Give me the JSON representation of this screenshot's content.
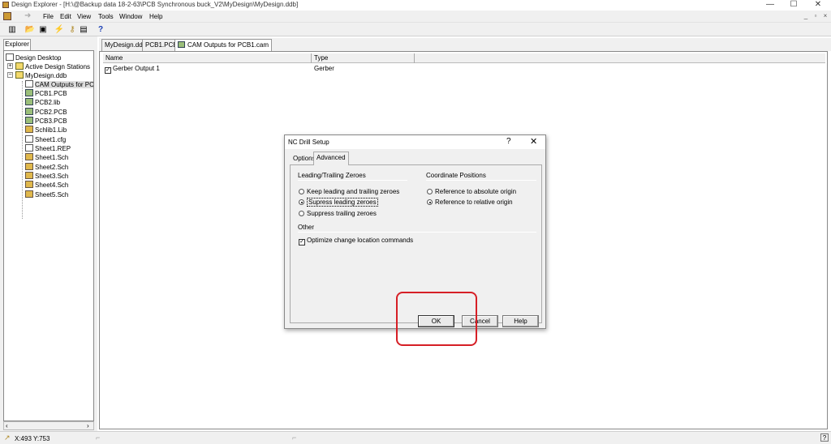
{
  "window": {
    "title": "Design Explorer - [H:\\@Backup data 18-2-63\\PCB Synchronous buck_V2\\MyDesign\\MyDesign.ddb]",
    "controls": [
      "—",
      "☐",
      "✕"
    ]
  },
  "menu": {
    "items": [
      "File",
      "Edit",
      "View",
      "Tools",
      "Window",
      "Help"
    ],
    "mdi_controls": [
      "_",
      "▫",
      "×"
    ]
  },
  "toolbar": {
    "help_glyph": "?"
  },
  "explorer": {
    "tab_label": "Explorer",
    "tree": [
      {
        "label": "Design Desktop",
        "kind": "doc"
      },
      {
        "label": "Active Design Stations",
        "kind": "folder"
      },
      {
        "label": "MyDesign.ddb",
        "kind": "folder"
      },
      {
        "label": "CAM Outputs for PC",
        "kind": "doc"
      },
      {
        "label": "PCB1.PCB",
        "kind": "pcb"
      },
      {
        "label": "PCB2.lib",
        "kind": "pcb"
      },
      {
        "label": "PCB2.PCB",
        "kind": "pcb"
      },
      {
        "label": "PCB3.PCB",
        "kind": "pcb"
      },
      {
        "label": "Schlib1.Lib",
        "kind": "sch"
      },
      {
        "label": "Sheet1.cfg",
        "kind": "doc"
      },
      {
        "label": "Sheet1.REP",
        "kind": "doc"
      },
      {
        "label": "Sheet1.Sch",
        "kind": "sch"
      },
      {
        "label": "Sheet2.Sch",
        "kind": "sch"
      },
      {
        "label": "Sheet3.Sch",
        "kind": "sch"
      },
      {
        "label": "Sheet4.Sch",
        "kind": "sch"
      },
      {
        "label": "Sheet5.Sch",
        "kind": "sch"
      }
    ]
  },
  "doc_tabs": [
    "MyDesign.ddb",
    "PCB1.PCB",
    "CAM Outputs for PCB1.cam"
  ],
  "list": {
    "columns": [
      "Name",
      "Type"
    ],
    "rows": [
      {
        "name": "Gerber Output 1",
        "type": "Gerber",
        "checked": true
      }
    ]
  },
  "status": {
    "coords": "X:493 Y:753"
  },
  "dialog": {
    "title": "NC Drill Setup",
    "help_glyph": "?",
    "close_glyph": "✕",
    "tabs": [
      "Options",
      "Advanced"
    ],
    "active_tab": "Advanced",
    "leading_group": {
      "title": "Leading/Trailing Zeroes",
      "options": [
        "Keep leading and trailing zeroes",
        "Supress leading zeroes",
        "Suppress trailing zeroes"
      ],
      "selected": 1
    },
    "coord_group": {
      "title": "Coordinate Positions",
      "options": [
        "Reference to absolute origin",
        "Reference to relative origin"
      ],
      "selected": 1
    },
    "other_group": {
      "title": "Other",
      "checkbox_label": "Optimize change location commands",
      "checked": true
    },
    "buttons": {
      "ok": "OK",
      "cancel": "Cancel",
      "help": "Help"
    }
  },
  "colors": {
    "annotation": "#d61f26",
    "face": "#f0f0f0"
  }
}
